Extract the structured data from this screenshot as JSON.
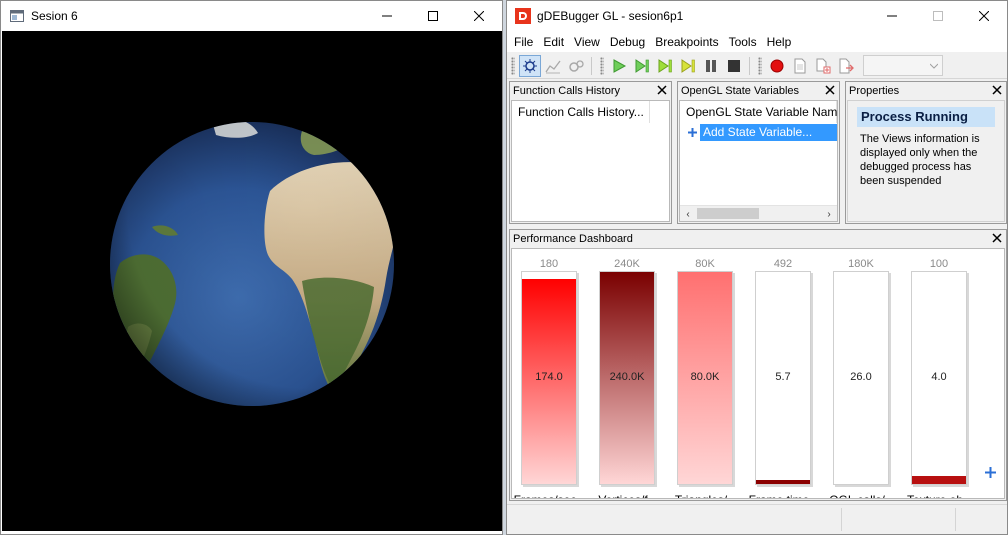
{
  "left_window": {
    "title": "Sesion 6"
  },
  "right_window": {
    "title": "gDEBugger GL - sesion6p1",
    "menu": [
      "File",
      "Edit",
      "View",
      "Debug",
      "Breakpoints",
      "Tools",
      "Help"
    ],
    "toolbar": {
      "icons": [
        "debug-mode-icon",
        "profile-mode-icon",
        "analyze-mode-icon",
        "go-icon",
        "frame-step-icon",
        "draw-step-icon",
        "api-step-icon",
        "pause-icon",
        "stop-icon",
        "record-icon",
        "page-icon",
        "copy-page-icon",
        "export-page-icon"
      ]
    },
    "panels": {
      "function_calls": {
        "title": "Function Calls History",
        "column": "Function Calls History..."
      },
      "state_variables": {
        "title": "OpenGL State Variables",
        "column": "OpenGL State Variable Name",
        "add_item": "Add State Variable..."
      },
      "properties": {
        "title": "Properties",
        "heading": "Process Running",
        "text": "The Views information is displayed only when the debugged process has been suspended"
      },
      "dashboard": {
        "title": "Performance Dashboard",
        "meters": [
          {
            "label": "Frames/sec...",
            "max": "180",
            "value": "174.0",
            "level": 0.967,
            "color": "#ff0000"
          },
          {
            "label": "Vertices/f...",
            "max": "240K",
            "value": "240.0K",
            "level": 1.0,
            "color": "#7a0000"
          },
          {
            "label": "Triangles/...",
            "max": "80K",
            "value": "80.0K",
            "level": 1.0,
            "color": "#ff7070"
          },
          {
            "label": "Frame time...",
            "max": "492",
            "value": "5.7",
            "level": 0.012,
            "color": "#8b0000"
          },
          {
            "label": "OGL calls/...",
            "max": "180K",
            "value": "26.0",
            "level": 0.0,
            "color": "#8b0000"
          },
          {
            "label": "Texture ob...",
            "max": "100",
            "value": "4.0",
            "level": 0.04,
            "color": "#b81010"
          }
        ]
      }
    }
  }
}
